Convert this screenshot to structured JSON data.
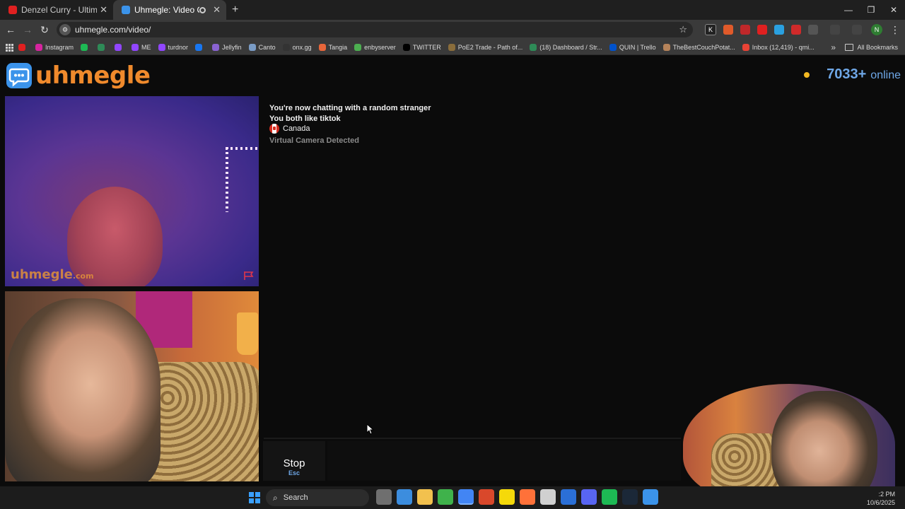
{
  "browser": {
    "tabs": [
      {
        "title": "Denzel Curry - Ultimate (BADB/",
        "color": "#e02020",
        "active": false
      },
      {
        "title": "Uhmegle: Video Chat | Om",
        "color": "#3b93ea",
        "active": true
      }
    ],
    "url": "uhmegle.com/video/",
    "bookmarks": [
      {
        "label": "",
        "color": "#e02020"
      },
      {
        "label": "Instagram",
        "color": "#d6249f"
      },
      {
        "label": "",
        "color": "#1db954"
      },
      {
        "label": "",
        "color": "#2e8b57"
      },
      {
        "label": "",
        "color": "#9146ff"
      },
      {
        "label": "ME",
        "color": "#9146ff"
      },
      {
        "label": "turdnor",
        "color": "#9146ff"
      },
      {
        "label": "",
        "color": "#1877f2"
      },
      {
        "label": "Jellyfin",
        "color": "#8a63d2"
      },
      {
        "label": "Canto",
        "color": "#7a9cc6"
      },
      {
        "label": "onx.gg",
        "color": "#333333"
      },
      {
        "label": "Tangia",
        "color": "#e8663a"
      },
      {
        "label": "enbyserver",
        "color": "#4caf50"
      },
      {
        "label": "TWITTER",
        "color": "#000000"
      },
      {
        "label": "PoE2 Trade - Path of...",
        "color": "#8a6d3b"
      },
      {
        "label": "(18) Dashboard / Str...",
        "color": "#2e8b57"
      },
      {
        "label": "QUIN | Trello",
        "color": "#0052cc"
      },
      {
        "label": "TheBestCouchPotat...",
        "color": "#b5835a"
      },
      {
        "label": "Inbox (12,419) - qmi...",
        "color": "#ea4335"
      }
    ],
    "all_bookmarks": "All Bookmarks",
    "profile_initial": "N"
  },
  "site": {
    "logo": "uhmegle",
    "online_count": "7033+",
    "online_label": "online",
    "watermark": "uhmegle",
    "watermark_suffix": ".com"
  },
  "chat": {
    "line1": "You're now chatting with a random stranger",
    "line2": "You both like tiktok",
    "country": "Canada",
    "notice": "Virtual Camera Detected"
  },
  "controls": {
    "stop_label": "Stop",
    "stop_key": "Esc"
  },
  "taskbar": {
    "search": "Search",
    "time": ":2 PM",
    "date": "10/6/2025",
    "apps": [
      "#6f6f6f",
      "#3c8dde",
      "#f2c14e",
      "#3fb24b",
      "#4285f4",
      "#d9482b",
      "#f5d90a",
      "#ff7139",
      "#d0d0d0",
      "#2b6fd6",
      "#5865f2",
      "#1db954",
      "#1b2838",
      "#3b93ea"
    ]
  }
}
